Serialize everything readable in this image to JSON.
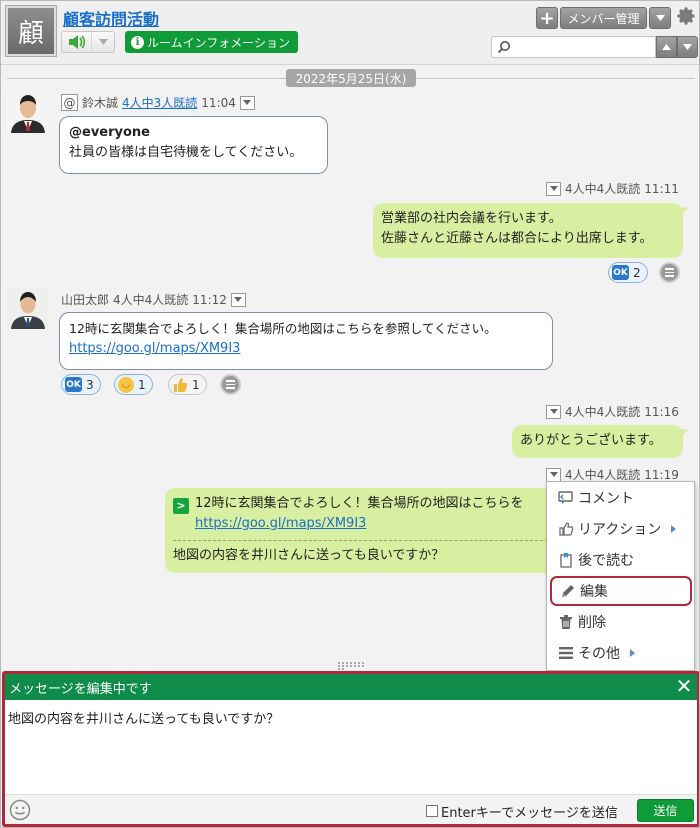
{
  "room": {
    "avatar_char": "顧",
    "title": "顧客訪問活動",
    "info_button": "ルームインフォメーション"
  },
  "header": {
    "add_label": "+",
    "member_manage": "メンバー管理",
    "search_placeholder": ""
  },
  "date_separator": "2022年5月25日(水)",
  "messages": [
    {
      "sender": "鈴木誠",
      "read": "4人中3人既読",
      "time": "11:04",
      "mention": "@everyone",
      "text": "社員の皆様は自宅待機をしてください。"
    },
    {
      "read": "4人中4人既読",
      "time": "11:11",
      "line1": "営業部の社内会議を行います。",
      "line2": "佐藤さんと近藤さんは都合により出席します。",
      "reaction_ok_count": "2"
    },
    {
      "sender": "山田太郎",
      "read": "4人中4人既読",
      "time": "11:12",
      "line1": "12時に玄関集合でよろしく！集合場所の地図はこちらを参照してください。",
      "link": "https://goo.gl/maps/XM9I3",
      "reaction_ok_count": "3",
      "reaction_smile_count": "1",
      "reaction_thumb_count": "1"
    },
    {
      "read": "4人中4人既読",
      "time": "11:16",
      "text": "ありがとうございます。"
    },
    {
      "read": "4人中4人既読",
      "time": "11:19",
      "quote": "12時に玄関集合でよろしく！集合場所の地図はこちらを",
      "quote_link": "https://goo.gl/maps/XM9I3",
      "text": "地図の内容を井川さんに送っても良いですか？"
    }
  ],
  "context_menu": {
    "comment": "コメント",
    "reaction": "リアクション",
    "read_later": "後で読む",
    "edit": "編集",
    "delete": "削除",
    "other": "その他"
  },
  "editor": {
    "header": "メッセージを編集中です",
    "close": "✕",
    "value": "地図の内容を井川さんに送っても良いですか？",
    "enter_send_label": "Enterキーでメッセージを送信",
    "send": "送信"
  },
  "colors": {
    "accent_green": "#0f9b37",
    "editor_header": "#0f8c4a",
    "highlight_red": "#b0283a",
    "bubble_right": "#d8eea0",
    "link_blue": "#1a6fc9"
  }
}
